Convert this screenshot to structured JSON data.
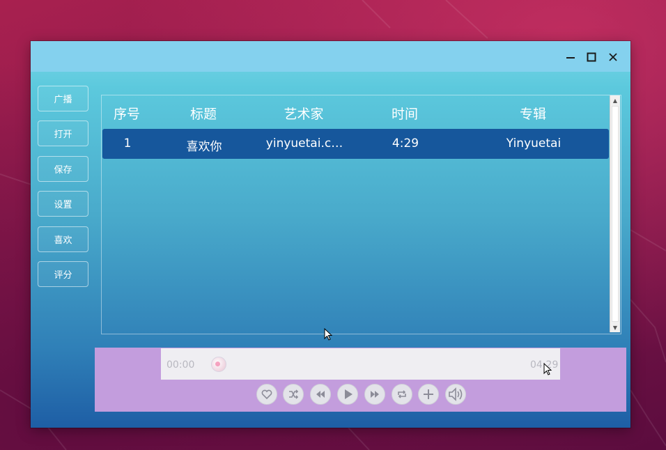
{
  "window": {
    "controls": {
      "minimize_icon": "minimize-icon",
      "maximize_icon": "maximize-icon",
      "close_icon": "close-icon"
    }
  },
  "sidebar": {
    "items": [
      {
        "label": "广播"
      },
      {
        "label": "打开"
      },
      {
        "label": "保存"
      },
      {
        "label": "设置"
      },
      {
        "label": "喜欢"
      },
      {
        "label": "评分"
      }
    ]
  },
  "playlist": {
    "columns": [
      "序号",
      "标题",
      "艺术家",
      "时间",
      "专辑"
    ],
    "rows": [
      {
        "index": "1",
        "title": "喜欢你",
        "artist": "yinyuetai.c…",
        "duration": "4:29",
        "album": "Yinyuetai"
      }
    ],
    "selected_row_color": "#16579c"
  },
  "player": {
    "current_time": "00:00",
    "total_time": "04:29",
    "progress": 0,
    "buttons": [
      "heart-icon",
      "shuffle-icon",
      "previous-icon",
      "play-icon",
      "next-icon",
      "repeat-icon",
      "add-icon",
      "volume-icon"
    ],
    "panel_color": "#c39ddd"
  }
}
